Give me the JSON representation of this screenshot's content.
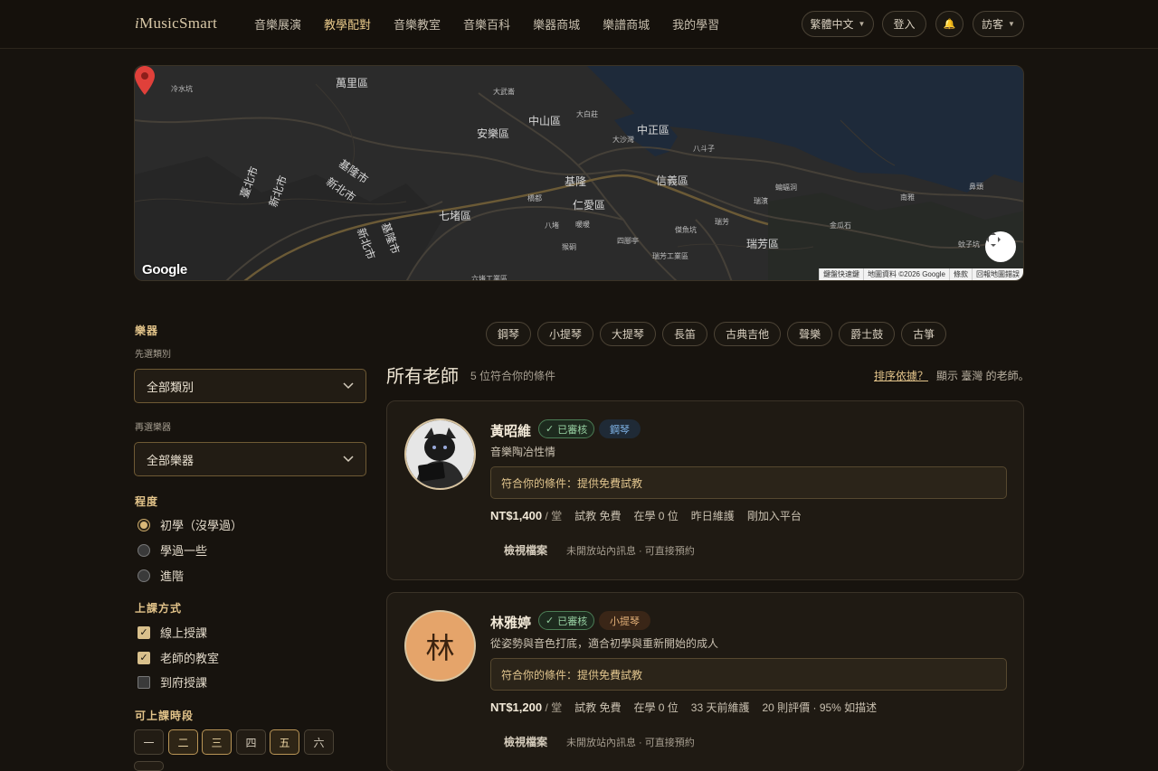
{
  "header": {
    "logo_prefix": "i",
    "logo_rest": "MusicSmart",
    "nav": [
      {
        "label": "音樂展演",
        "active": false
      },
      {
        "label": "教學配對",
        "active": true
      },
      {
        "label": "音樂教室",
        "active": false
      },
      {
        "label": "音樂百科",
        "active": false
      },
      {
        "label": "樂器商城",
        "active": false
      },
      {
        "label": "樂譜商城",
        "active": false
      },
      {
        "label": "我的學習",
        "active": false
      }
    ],
    "language": "繁體中文",
    "login": "登入",
    "bell_icon": "🔔",
    "visitor": "訪客"
  },
  "map": {
    "labels": {
      "wanli": "萬里區",
      "anle": "安樂區",
      "zhongshan": "中山區",
      "zhongzheng": "中正區",
      "xinyi": "信義區",
      "keelung": "基隆",
      "renai": "仁愛區",
      "qidu": "七堵區",
      "ruifang": "瑞芳區",
      "keelung_city1": "基隆市",
      "keelung_city2": "基隆市",
      "taipei_city": "臺北市",
      "new_taipei1": "新北市",
      "new_taipei2": "新北市",
      "new_taipei3": "新北市",
      "keelung_city3": "基隆市",
      "s1": "冷水坑",
      "s2": "大武崙",
      "s3": "大白莊",
      "s4": "大沙灣",
      "s5": "八斗子",
      "s6": "蝙蝠洞",
      "s7": "南雅",
      "s8": "鼻頭",
      "s9": "瑞濱",
      "s10": "金瓜石",
      "s11": "瑞芳",
      "s12": "猴硐",
      "s13": "四腳亭",
      "s14": "傑魚坑",
      "s15": "瑞芳工業區",
      "s16": "八堵",
      "s17": "暖暖",
      "s18": "橋都",
      "s19": "六堵工業區",
      "s20": "蚊子坑"
    },
    "google": "Google",
    "attribution": [
      "鍵盤快速鍵",
      "地圖資料 ©2026 Google",
      "條款",
      "回報地圖錯誤"
    ]
  },
  "sidebar": {
    "instrument_heading": "樂器",
    "category_sub": "先選類別",
    "category_value": "全部類別",
    "instrument_sub": "再選樂器",
    "instrument_value": "全部樂器",
    "level_heading": "程度",
    "levels": [
      {
        "label": "初學（沒學過）",
        "selected": true
      },
      {
        "label": "學過一些",
        "selected": false
      },
      {
        "label": "進階",
        "selected": false
      }
    ],
    "mode_heading": "上課方式",
    "modes": [
      {
        "label": "線上授課",
        "checked": true
      },
      {
        "label": "老師的教室",
        "checked": true
      },
      {
        "label": "到府授課",
        "checked": false
      }
    ],
    "time_heading": "可上課時段",
    "days": [
      {
        "label": "一",
        "on": false
      },
      {
        "label": "二",
        "on": true
      },
      {
        "label": "三",
        "on": true
      },
      {
        "label": "四",
        "on": false
      },
      {
        "label": "五",
        "on": true
      },
      {
        "label": "六",
        "on": false
      }
    ]
  },
  "chips": [
    "鋼琴",
    "小提琴",
    "大提琴",
    "長笛",
    "古典吉他",
    "聲樂",
    "爵士鼓",
    "古箏"
  ],
  "list": {
    "title": "所有老師",
    "count": "5 位符合你的條件",
    "sort_link": "排序依據？",
    "sort_note": "顯示 臺灣 的老師。"
  },
  "teachers": [
    {
      "name": "黃昭維",
      "verified": "已審核",
      "instrument": "鋼琴",
      "instrument_color": "#7fb3e6",
      "instrument_bg": "#1f2a36",
      "desc": "音樂陶冶性情",
      "match": "符合你的條件：提供免費試教",
      "price": "NT$1,400",
      "per": "/ 堂",
      "trial": "試教 免費",
      "students": "在學 0 位",
      "maintained": "昨日維護",
      "extra": "剛加入平台",
      "profile": "檢視檔案",
      "msg": "未開放站內訊息 · 可直接預約",
      "avatar_type": "photo"
    },
    {
      "name": "林雅婷",
      "verified": "已審核",
      "instrument": "小提琴",
      "instrument_color": "#e3b078",
      "instrument_bg": "#3a2617",
      "desc": "從姿勢與音色打底，適合初學與重新開始的成人",
      "match": "符合你的條件：提供免費試教",
      "price": "NT$1,200",
      "per": "/ 堂",
      "trial": "試教 免費",
      "students": "在學 0 位",
      "maintained": "33 天前維護",
      "extra": "20 則評價 · 95% 如描述",
      "profile": "檢視檔案",
      "msg": "未開放站內訊息 · 可直接預約",
      "avatar_letter": "林"
    }
  ]
}
